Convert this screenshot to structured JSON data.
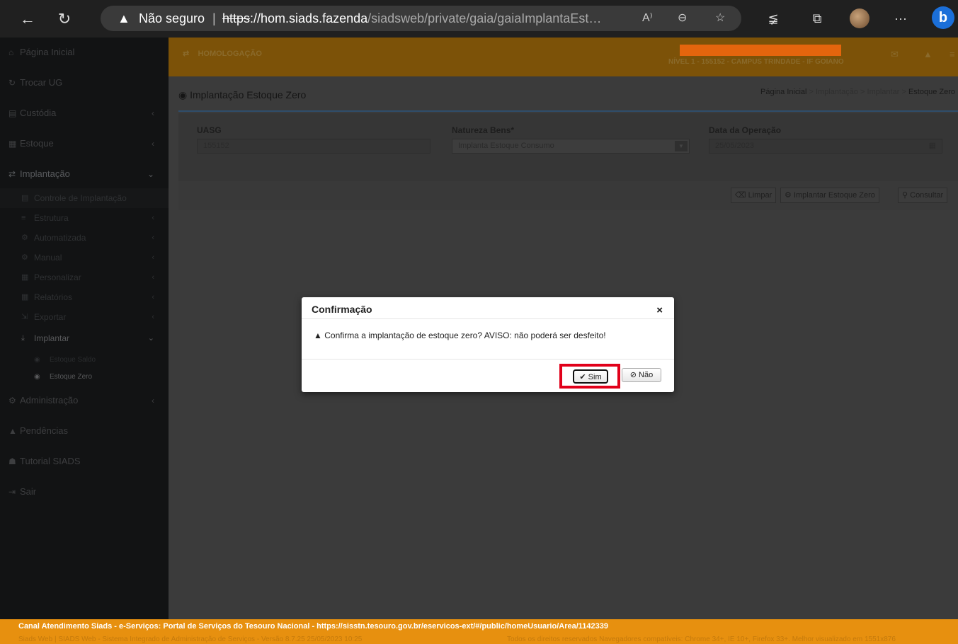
{
  "browser": {
    "back_icon": "←",
    "refresh_icon": "↻",
    "security_label": "Não seguro",
    "url_scheme": "https",
    "url_host": "://hom.siads.fazenda",
    "url_path": "/siadsweb/private/gaia/gaiaImplantaEst…",
    "read_aloud": "A⁾",
    "zoom": "⊖",
    "favorite": "☆",
    "favorites_bar": "≨",
    "collections": "⧉",
    "more": "···",
    "bing": "b"
  },
  "sidebar": {
    "items": [
      {
        "icon": "⌂",
        "label": "Página Inicial"
      },
      {
        "icon": "↻",
        "label": "Trocar UG"
      },
      {
        "icon": "▤",
        "label": "Custódia",
        "arrow": "‹"
      },
      {
        "icon": "▦",
        "label": "Estoque",
        "arrow": "‹"
      },
      {
        "icon": "⇄",
        "label": "Implantação",
        "arrow": "⌄"
      }
    ],
    "sub_items": [
      {
        "icon": "▤",
        "label": "Controle de Implantação"
      },
      {
        "icon": "≡",
        "label": "Estrutura",
        "arrow": "‹"
      },
      {
        "icon": "⚙",
        "label": "Automatizada",
        "arrow": "‹"
      },
      {
        "icon": "⚙",
        "label": "Manual",
        "arrow": "‹"
      },
      {
        "icon": "▦",
        "label": "Personalizar",
        "arrow": "‹"
      },
      {
        "icon": "▦",
        "label": "Relatórios",
        "arrow": "‹"
      },
      {
        "icon": "⇲",
        "label": "Exportar",
        "arrow": "‹"
      },
      {
        "icon": "⤓",
        "label": "Implantar",
        "arrow": "⌄"
      }
    ],
    "subsub_items": [
      {
        "icon": "◉",
        "label": "Estoque Saldo"
      },
      {
        "icon": "◉",
        "label": "Estoque Zero"
      }
    ],
    "bottom_items": [
      {
        "icon": "⚙",
        "label": "Administração",
        "arrow": "‹"
      },
      {
        "icon": "▲",
        "label": "Pendências"
      },
      {
        "icon": "☗",
        "label": "Tutorial SIADS"
      },
      {
        "icon": "⇥",
        "label": "Sair"
      }
    ]
  },
  "topbar": {
    "env_icon": "⇄",
    "env": "HOMOLOGAÇÃO",
    "nivel": "NÍVEL 1 - 155152 - CAMPUS TRINDADE - IF GOIANO",
    "mail_icon": "✉",
    "alert_icon": "▲",
    "menu_icon": "≡"
  },
  "page": {
    "title_icon": "◉",
    "title": "Implantação Estoque Zero",
    "breadcrumb": [
      "Página Inicial",
      "Implantação",
      "Implantar",
      "Estoque Zero"
    ],
    "breadcrumb_sep": ">"
  },
  "form": {
    "uasg_label": "UASG",
    "uasg_value": "155152",
    "natureza_label": "Natureza Bens*",
    "natureza_value": "Implanta Estoque Consumo",
    "data_label": "Data da Operação",
    "data_value": "25/05/2023",
    "cal_icon": "▦"
  },
  "actions": {
    "limpar": "Limpar",
    "implantar": "Implantar Estoque Zero",
    "consultar": "Consultar"
  },
  "modal": {
    "title": "Confirmação",
    "close": "×",
    "warn_icon": "▲",
    "message": "Confirma a implantação de estoque zero? AVISO: não poderá ser desfeito!",
    "sim": "✔ Sim",
    "nao": "⊘ Não"
  },
  "footer": {
    "line1": "Canal Atendimento Siads - e-Serviços: Portal de Serviços do Tesouro Nacional - https://sisstn.tesouro.gov.br/eservicos-ext/#/public/homeUsuario/Area/1142339",
    "line2": "Siads Web | SIADS Web - Sistema Integrado de Administração de Serviços - Versão 8.7.25 25/05/2023 10:25",
    "line3": "Todos os direitos reservados Navegadores compatíveis: Chrome 34+, IE 10+, Firefox 33+. Melhor visualizado em 1551x876"
  },
  "colors": {
    "accent": "#e7900f",
    "highlight": "#e1001a"
  }
}
